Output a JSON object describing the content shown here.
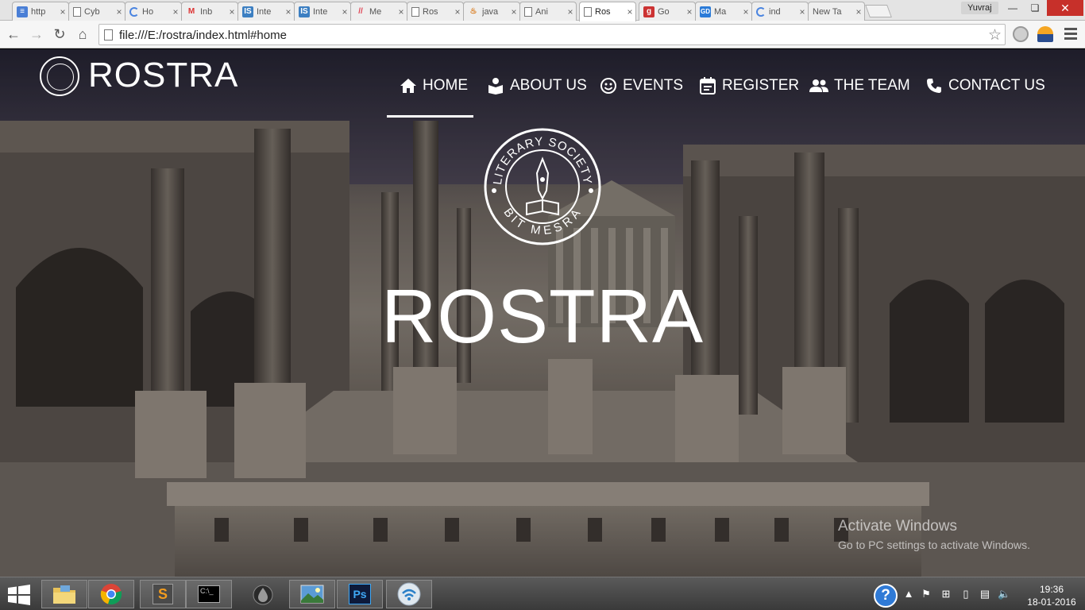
{
  "browser": {
    "tabs": [
      {
        "title": "http",
        "icon": "docs-icon"
      },
      {
        "title": "Cyb",
        "icon": "page-icon"
      },
      {
        "title": "Ho",
        "icon": "loading-icon"
      },
      {
        "title": "Inb",
        "icon": "gmail-icon"
      },
      {
        "title": "Inte",
        "icon": "is-icon"
      },
      {
        "title": "Inte",
        "icon": "is-icon"
      },
      {
        "title": "Me",
        "icon": "me-icon"
      },
      {
        "title": "Ros",
        "icon": "page-icon"
      },
      {
        "title": "java",
        "icon": "java-icon"
      },
      {
        "title": "Ani",
        "icon": "page-icon"
      },
      {
        "title": "Ros",
        "icon": "page-icon",
        "active": true
      },
      {
        "title": "Go",
        "icon": "go-icon"
      },
      {
        "title": "Ma",
        "icon": "gd-icon"
      },
      {
        "title": "ind",
        "icon": "loading-icon"
      },
      {
        "title": "New Ta",
        "icon": "none"
      }
    ],
    "close_glyph": "×",
    "profile_name": "Yuvraj",
    "url": "file:///E:/rostra/index.html#home"
  },
  "site": {
    "brand": "ROSTRA",
    "nav": [
      {
        "label": "HOME",
        "icon": "home-icon",
        "active": true
      },
      {
        "label": "ABOUT US",
        "icon": "book-icon"
      },
      {
        "label": "EVENTS",
        "icon": "smiley-icon"
      },
      {
        "label": "REGISTER",
        "icon": "calendar-icon"
      },
      {
        "label": "THE TEAM",
        "icon": "people-icon"
      },
      {
        "label": "CONTACT US",
        "icon": "phone-icon"
      }
    ],
    "emblem": {
      "top_text": "LITERARY SOCIETY",
      "bottom_text": "BIT MESRA"
    },
    "hero_title": "ROSTRA"
  },
  "watermark": {
    "heading": "Activate Windows",
    "subtext": "Go to PC settings to activate Windows."
  },
  "taskbar": {
    "apps": [
      "file-explorer-icon",
      "chrome-icon",
      "sublime-text-icon",
      "command-prompt-icon",
      "app-drop-icon",
      "photo-viewer-icon",
      "photoshop-icon",
      "network-app-icon"
    ],
    "photoshop_label": "Ps",
    "sublime_label": "S",
    "cmd_label": "C:\\_",
    "help_label": "?",
    "time": "19:36",
    "date": "18-01-2016"
  }
}
